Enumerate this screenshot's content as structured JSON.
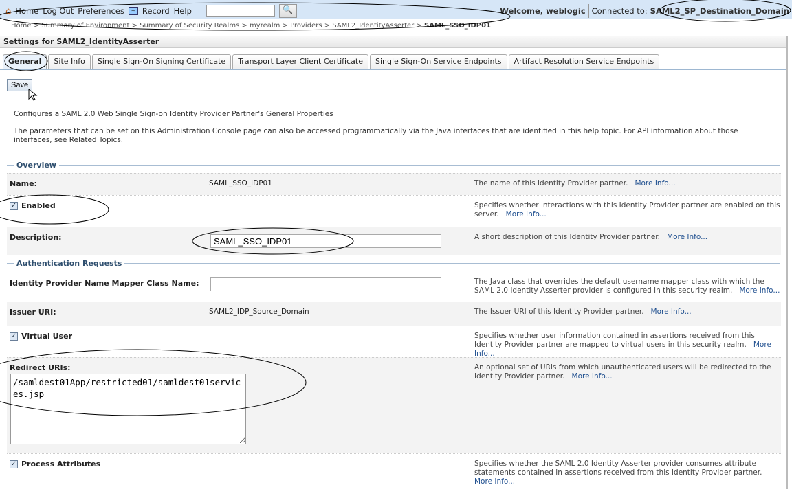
{
  "topbar": {
    "home": "Home",
    "logout": "Log Out",
    "preferences": "Preferences",
    "record": "Record",
    "help": "Help",
    "search_value": "",
    "welcome": "Welcome, weblogic",
    "connected_label": "Connected to:",
    "domain": "SAML2_SP_Destination_Domain"
  },
  "breadcrumb": {
    "items": [
      "Home >",
      "Summary of Environment >",
      "Summary of Security Realms >",
      "myrealm >",
      "Providers >",
      "SAML2_IdentityAsserter >"
    ],
    "current": "SAML_SSO_IDP01"
  },
  "panel": {
    "title": "Settings for SAML2_IdentityAsserter"
  },
  "tabs": [
    "General",
    "Site Info",
    "Single Sign-On Signing Certificate",
    "Transport Layer Client Certificate",
    "Single Sign-On Service Endpoints",
    "Artifact Resolution Service Endpoints"
  ],
  "save_label": "Save",
  "intro": {
    "line1": "Configures a SAML 2.0 Web Single Sign-on Identity Provider Partner's General Properties",
    "line2": "The parameters that can be set on this Administration Console page can also be accessed programmatically via the Java interfaces that are identified in this help topic. For API information about those interfaces, see Related Topics."
  },
  "sections": {
    "overview": "Overview",
    "auth": "Authentication Requests"
  },
  "more_info": "More Info...",
  "fields": {
    "name": {
      "label": "Name:",
      "value": "SAML_SSO_IDP01",
      "help": "The name of this Identity Provider partner."
    },
    "enabled": {
      "label": "Enabled",
      "checked": true,
      "help": "Specifies whether interactions with this Identity Provider partner are enabled on this server."
    },
    "description": {
      "label": "Description:",
      "value": "SAML_SSO_IDP01",
      "help": "A short description of this Identity Provider partner."
    },
    "mapper": {
      "label": "Identity Provider Name Mapper Class Name:",
      "value": "",
      "help": "The Java class that overrides the default username mapper class with which the SAML 2.0 Identity Asserter provider is configured in this security realm."
    },
    "issuer": {
      "label": "Issuer URI:",
      "value": "SAML2_IDP_Source_Domain",
      "help": "The Issuer URI of this Identity Provider partner."
    },
    "virtual_user": {
      "label": "Virtual User",
      "checked": true,
      "help": "Specifies whether user information contained in assertions received from this Identity Provider partner are mapped to virtual users in this security realm."
    },
    "redirect": {
      "label": "Redirect URIs:",
      "value": "/samldest01App/restricted01/samldest01services.jsp",
      "help": "An optional set of URIs from which unauthenticated users will be redirected to the Identity Provider partner."
    },
    "process_attrs": {
      "label": "Process Attributes",
      "checked": true,
      "help": "Specifies whether the SAML 2.0 Identity Asserter provider consumes attribute statements contained in assertions received from this Identity Provider partner."
    }
  }
}
